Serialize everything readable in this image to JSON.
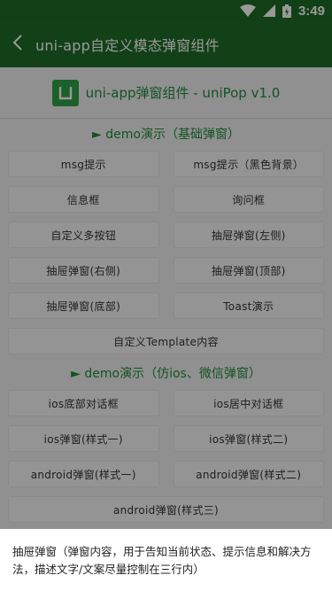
{
  "status_bar": {
    "time": "3:49"
  },
  "app_bar": {
    "title": "uni-app自定义模态弹窗组件"
  },
  "header": {
    "title": "uni-app弹窗组件 - uniPop v1.0"
  },
  "sections": [
    {
      "title": "► demo演示（基础弹窗）",
      "buttons": [
        "msg提示",
        "msg提示（黑色背景）",
        "信息框",
        "询问框",
        "自定义多按钮",
        "抽屉弹窗(左侧)",
        "抽屉弹窗(右侧)",
        "抽屉弹窗(顶部)",
        "抽屉弹窗(底部)",
        "Toast演示",
        "自定义Template内容"
      ]
    },
    {
      "title": "► demo演示（仿ios、微信弹窗）",
      "buttons": [
        "ios底部对话框",
        "ios居中对话框",
        "ios弹窗(样式一)",
        "ios弹窗(样式二)",
        "android弹窗(样式一)",
        "android弹窗(样式二)",
        "android弹窗(样式三)"
      ]
    }
  ],
  "bottom_sheet": {
    "text": "抽屉弹窗（弹窗内容，用于告知当前状态、提示信息和解决方法，描述文字/文案尽量控制在三行内）"
  },
  "colors": {
    "appbar": "#1f6b27",
    "accent": "#1f8a3b",
    "logo": "#2fa047"
  },
  "icons": [
    "wifi-icon",
    "signal-icon",
    "battery-icon",
    "back-arrow-icon",
    "logo-icon"
  ]
}
